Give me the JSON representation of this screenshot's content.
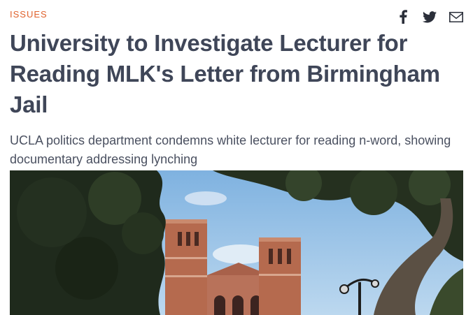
{
  "article": {
    "category": "ISSUES",
    "headline": "University to Investigate Lecturer for Reading MLK's Letter from Birmingham Jail",
    "dek": "UCLA politics department condemns white lecturer for reading n-word, showing documentary addressing lynching"
  },
  "share": {
    "icons": [
      "facebook-icon",
      "twitter-icon",
      "email-icon"
    ]
  },
  "colors": {
    "category": "#e0622d",
    "headline": "#3f4658",
    "dek": "#4a5060",
    "icons": "#2b2f3a"
  }
}
